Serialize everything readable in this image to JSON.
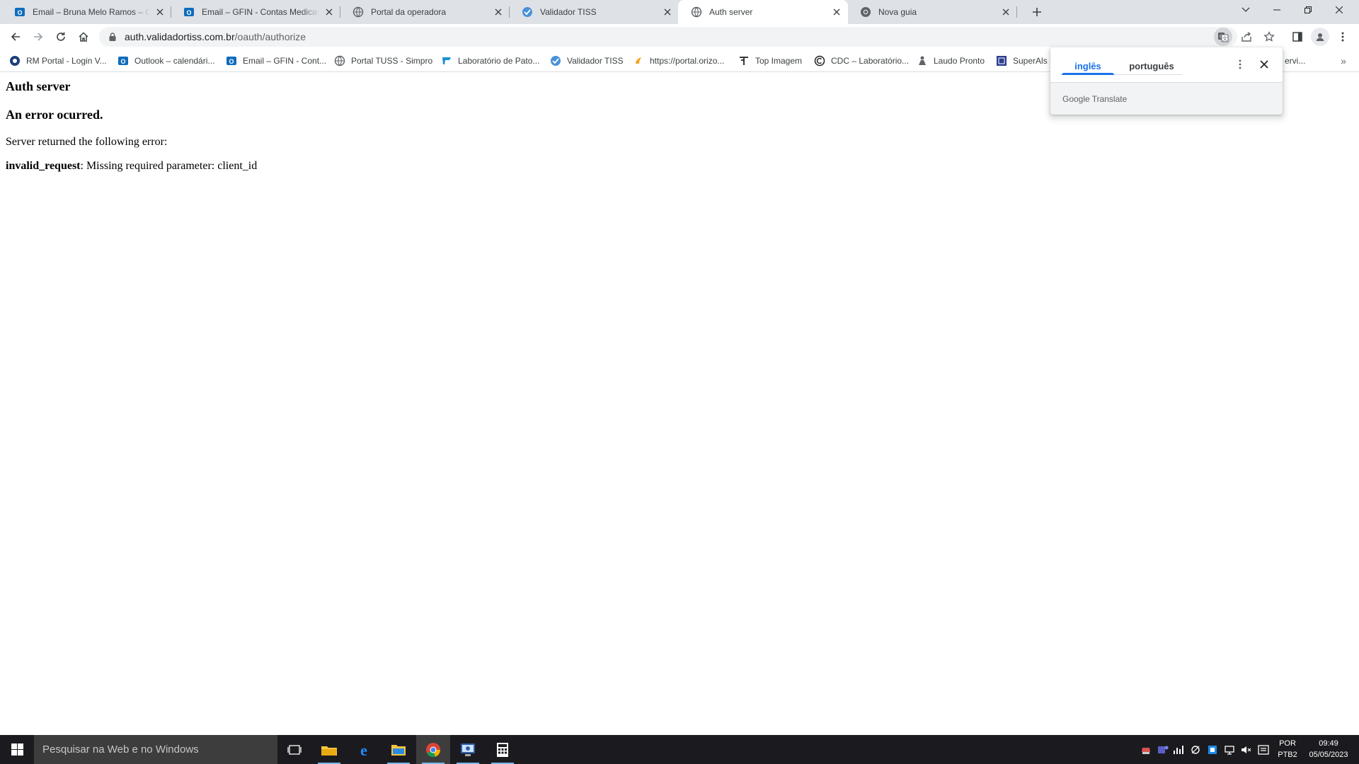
{
  "browser": {
    "tabs": [
      {
        "title": "Email – Bruna Melo Ramos – Outlook",
        "icon": "outlook-icon"
      },
      {
        "title": "Email – GFIN - Contas Medicas - Outlook",
        "icon": "outlook-icon"
      },
      {
        "title": "Portal da operadora",
        "icon": "globe-icon"
      },
      {
        "title": "Validador TISS",
        "icon": "validador-icon"
      },
      {
        "title": "Auth server",
        "icon": "globe-icon",
        "active": true
      },
      {
        "title": "Nova guia",
        "icon": "chrome-icon"
      }
    ],
    "address": {
      "host": "auth.validadortiss.com.br",
      "path": "/oauth/authorize"
    },
    "bookmarks": [
      {
        "label": "RM Portal - Login V...",
        "icon": "rm-icon"
      },
      {
        "label": "Outlook – calendári...",
        "icon": "outlook-icon"
      },
      {
        "label": "Email – GFIN - Cont...",
        "icon": "outlook-icon"
      },
      {
        "label": "Portal TUSS - Simpro",
        "icon": "globe-icon"
      },
      {
        "label": "Laboratório de Pato...",
        "icon": "lab-icon"
      },
      {
        "label": "Validador TISS",
        "icon": "validador-icon"
      },
      {
        "label": "https://portal.orizo...",
        "icon": "orizon-icon"
      },
      {
        "label": "Top Imagem",
        "icon": "topimagem-icon"
      },
      {
        "label": "CDC – Laboratório...",
        "icon": "cdc-icon"
      },
      {
        "label": "Laudo Pronto",
        "icon": "laudo-icon"
      },
      {
        "label": "SuperAls",
        "icon": "superals-icon"
      },
      {
        "label": "ervi...",
        "icon": "none"
      }
    ],
    "more_bookmarks": "»"
  },
  "translate_popup": {
    "source_language": "inglês",
    "target_language": "português",
    "brand": "Google",
    "product": "Translate"
  },
  "page": {
    "title": "Auth server",
    "heading": "An error ocurred.",
    "message": "Server returned the following error:",
    "error_code": "invalid_request",
    "error_description": ": Missing required parameter: client_id"
  },
  "taskbar": {
    "search_placeholder": "Pesquisar na Web e no Windows",
    "apps": [
      "task-view-icon",
      "file-explorer-icon",
      "edge-icon",
      "folder-icon",
      "chrome-icon",
      "remote-app-icon",
      "calculator-icon"
    ],
    "language_line1": "POR",
    "language_line2": "PTB2",
    "time": "09:49",
    "date": "05/05/2023"
  },
  "colors": {
    "accent": "#1a73e8",
    "tabstrip": "#dee1e6",
    "taskbar": "#1b1b1f"
  }
}
